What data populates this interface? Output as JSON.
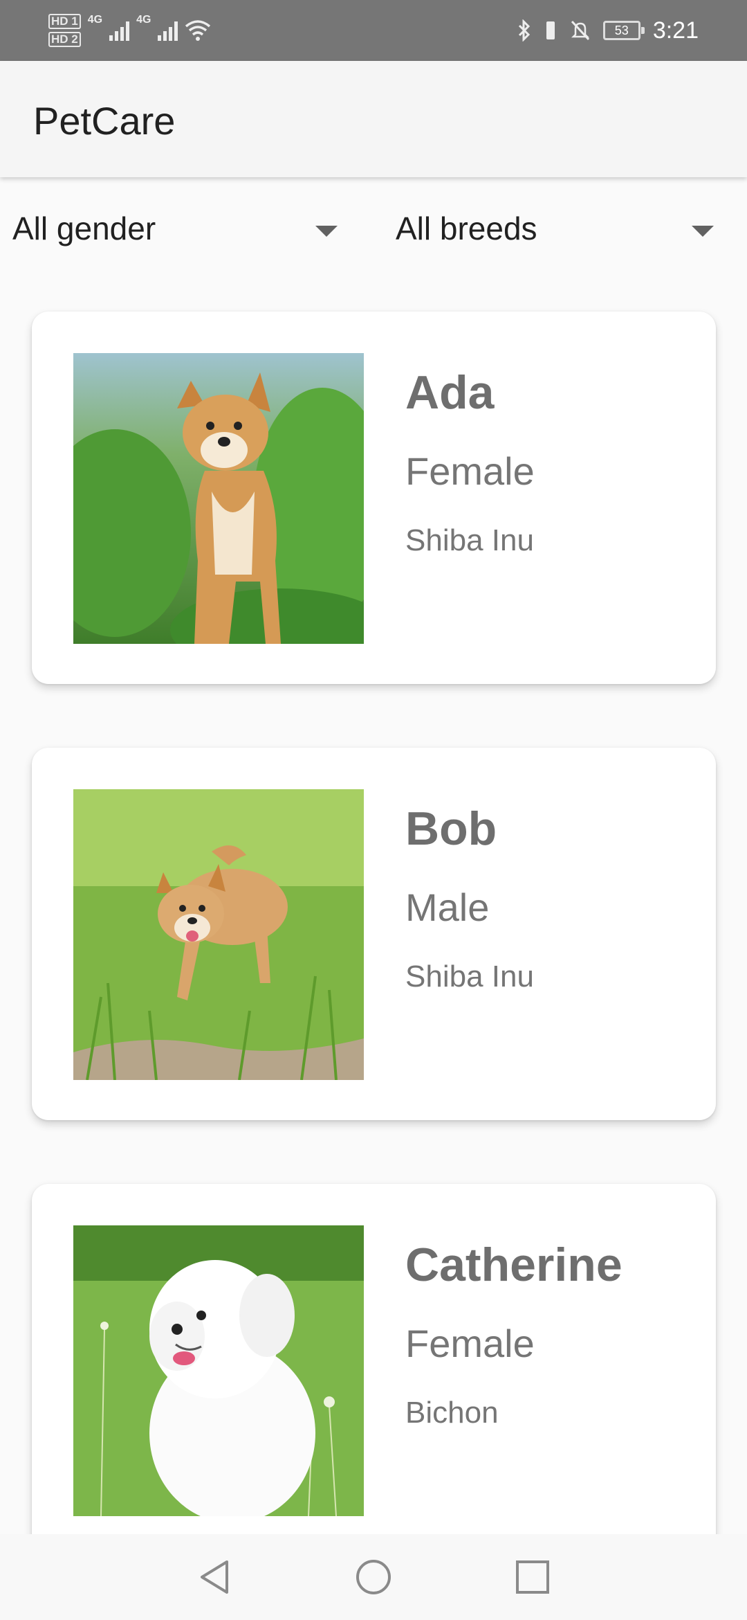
{
  "status_bar": {
    "sim1_label": "HD 1",
    "sim2_label": "HD 2",
    "network_1": "4G",
    "network_2": "4G",
    "battery_level": "53",
    "time": "3:21",
    "icons": [
      "signal-icon",
      "wifi-icon",
      "bluetooth-icon",
      "vibrate-icon",
      "mute-icon",
      "battery-icon"
    ]
  },
  "app": {
    "title": "PetCare"
  },
  "filters": {
    "gender": {
      "selected": "All gender"
    },
    "breed": {
      "selected": "All breeds"
    }
  },
  "pets": [
    {
      "name": "Ada",
      "gender": "Female",
      "breed": "Shiba Inu"
    },
    {
      "name": "Bob",
      "gender": "Male",
      "breed": "Shiba Inu"
    },
    {
      "name": "Catherine",
      "gender": "Female",
      "breed": "Bichon"
    }
  ],
  "nav": {
    "icons": [
      "back-icon",
      "home-icon",
      "recents-icon"
    ]
  },
  "colors": {
    "status_bar": "#767676",
    "app_bar": "#f5f5f5",
    "background": "#fafafa",
    "card": "#ffffff",
    "text_secondary": "#757575"
  }
}
